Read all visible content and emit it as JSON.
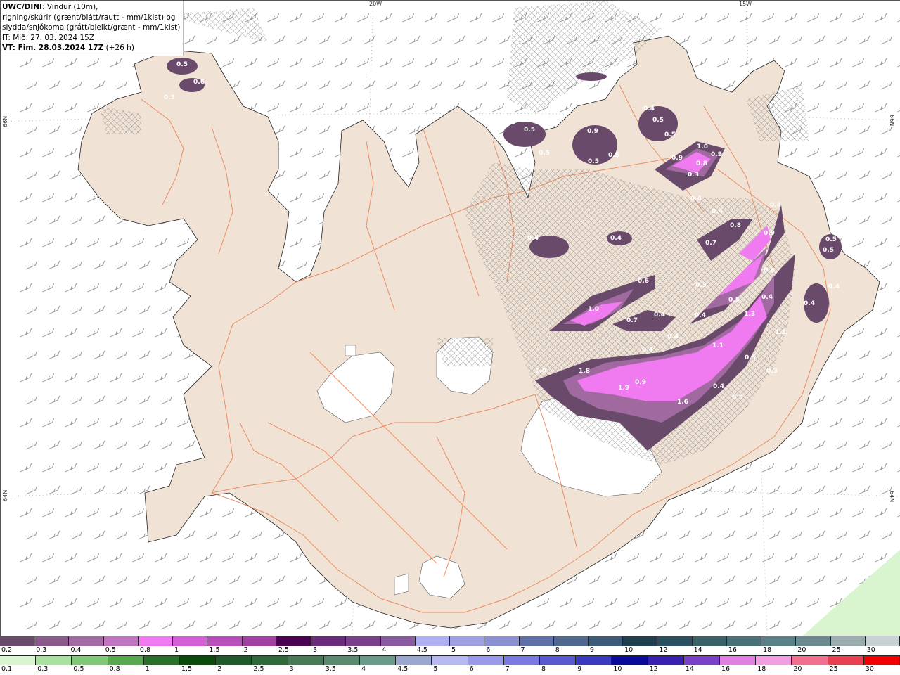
{
  "header": {
    "model": "UWC/DINI",
    "desc_line1": ": Vindur (10m),",
    "desc_line2": "rigning/skúrir (grænt/blátt/rautt - mm/1klst) og",
    "desc_line3": "slydda/snjókoma (grátt/bleikt/grænt - mm/1klst)",
    "it_line": "IT: Mið. 27. 03. 2024 15Z",
    "vt_bold": "VT: Fim. 28.03.2024 17Z",
    "vt_rest": " (+26 h)"
  },
  "graticule": {
    "lon_20w": "20W",
    "lon_15w": "15W",
    "lat_66n_left": "66N",
    "lat_66n_right": "66N",
    "lat_64n_left": "64N",
    "lat_64n_right": "64N"
  },
  "colors": {
    "land": "#f0e3d6",
    "road": "#e8845a",
    "sea": "#ffffff",
    "glacier": "#ffffff"
  },
  "precip_labels": [
    "0.5",
    "0.6",
    "0.3",
    "0.5",
    "0.5",
    "0.5",
    "0.9",
    "0.5",
    "0.5",
    "0.4",
    "0.5",
    "0.5",
    "1.0",
    "0.9",
    "0.9",
    "0.8",
    "0.3",
    "0.4",
    "0.4",
    "0.8",
    "0.4",
    "0.4",
    "0.7",
    "0.9",
    "0.4",
    "0.8",
    "0.5",
    "0.5",
    "0.6",
    "0.3",
    "0.4",
    "1.0",
    "0.5",
    "0.7",
    "0.4",
    "0.4",
    "1.3",
    "0.4",
    "0.4",
    "0.4",
    "1.1",
    "1.1",
    "0.3",
    "1.0",
    "1.8",
    "1.9",
    "0.9",
    "1.6",
    "0.4",
    "0.5",
    "0.4",
    "0.3"
  ],
  "legend_snow": {
    "labels": [
      "0.2",
      "0.3",
      "0.4",
      "0.5",
      "0.8",
      "1",
      "1.5",
      "2",
      "2.5",
      "3",
      "3.5",
      "4",
      "4.5",
      "5",
      "6",
      "7",
      "8",
      "9",
      "10",
      "12",
      "14",
      "16",
      "18",
      "20",
      "25",
      "30"
    ],
    "colors": [
      "#6a4a6a",
      "#8a5a8a",
      "#a36ba3",
      "#c075c0",
      "#f07af0",
      "#d45fd4",
      "#b84fb8",
      "#a040a0",
      "#4a0050",
      "#6a2a7a",
      "#7a3f8a",
      "#8a5aa0",
      "#b0b0f0",
      "#a0a0e0",
      "#8a90d0",
      "#6070a8",
      "#506890",
      "#3a5a78",
      "#204050",
      "#2a5060",
      "#3a6068",
      "#4a7078",
      "#5a8088",
      "#6a8a90",
      "#9aaeb0",
      "#c8d2d4"
    ]
  },
  "legend_rain": {
    "labels": [
      "0.1",
      "0.3",
      "0.5",
      "0.8",
      "1",
      "1.5",
      "2",
      "2.5",
      "3",
      "3.5",
      "4",
      "4.5",
      "5",
      "6",
      "7",
      "8",
      "9",
      "10",
      "12",
      "14",
      "16",
      "18",
      "20",
      "25",
      "30"
    ],
    "colors": [
      "#d8f5d0",
      "#a8e0a0",
      "#80c878",
      "#58a850",
      "#2a7028",
      "#0a4a0a",
      "#1e5a2a",
      "#2e6a3a",
      "#487a58",
      "#5a8a70",
      "#6a9a8a",
      "#9aa8d0",
      "#b8b8f0",
      "#9a9ae8",
      "#7a7ae0",
      "#5a5ad0",
      "#3a3ac0",
      "#0a0a9a",
      "#3a20b0",
      "#7a40c8",
      "#e080e0",
      "#f0a0e0",
      "#f07090",
      "#e84050",
      "#f00000"
    ]
  }
}
